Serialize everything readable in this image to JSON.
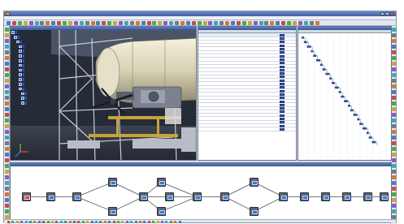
{
  "window": {
    "title": "",
    "menu": [
      "",
      "",
      "",
      "",
      "",
      "",
      "",
      ""
    ]
  },
  "tree": {
    "nodes": [
      "",
      "",
      "",
      "",
      "",
      "",
      "",
      "",
      "",
      "",
      "",
      "",
      "",
      "",
      "",
      ""
    ]
  },
  "table": {
    "columns": [
      "",
      "",
      "",
      "",
      "",
      "",
      "",
      ""
    ],
    "rows": 28
  },
  "gantt": {
    "header": "",
    "tasks": 24
  },
  "flow": {
    "title": "",
    "node_count": 19
  },
  "colors": {
    "title_bar": "#3b5fa5",
    "node_blue": "#3a78d8",
    "node_start": "#e03a3a"
  }
}
